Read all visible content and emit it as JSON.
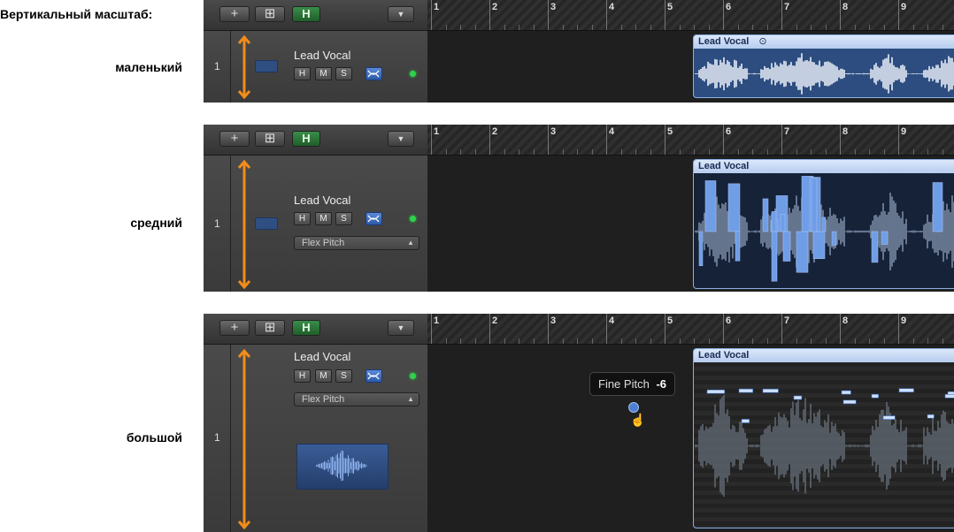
{
  "labels": {
    "heading": "Вертикальный масштаб:",
    "small": "маленький",
    "medium": "средний",
    "large": "большой"
  },
  "toolbar": {
    "add_icon": "plus-icon",
    "folder_icon": "new-track-stack-icon",
    "h_label": "H",
    "collapse_icon": "chevron-down-icon"
  },
  "ruler": {
    "bars": [
      "1",
      "2",
      "3",
      "4",
      "5",
      "6",
      "7",
      "8",
      "9"
    ]
  },
  "track": {
    "number": "1",
    "name": "Lead Vocal",
    "hide_label": "H",
    "mute_label": "M",
    "solo_label": "S",
    "flex_mode": "Flex Pitch"
  },
  "region": {
    "name": "Lead Vocal",
    "loop_icon": "loop-icon"
  },
  "tooltip": {
    "label": "Fine Pitch",
    "value": "-6"
  },
  "colors": {
    "accent_orange": "#f28c1a",
    "region_blue": "#2f4f82",
    "header_blue": "#c9daf5",
    "led_green": "#2fd34a",
    "h_button_green": "#2e7d3d"
  }
}
